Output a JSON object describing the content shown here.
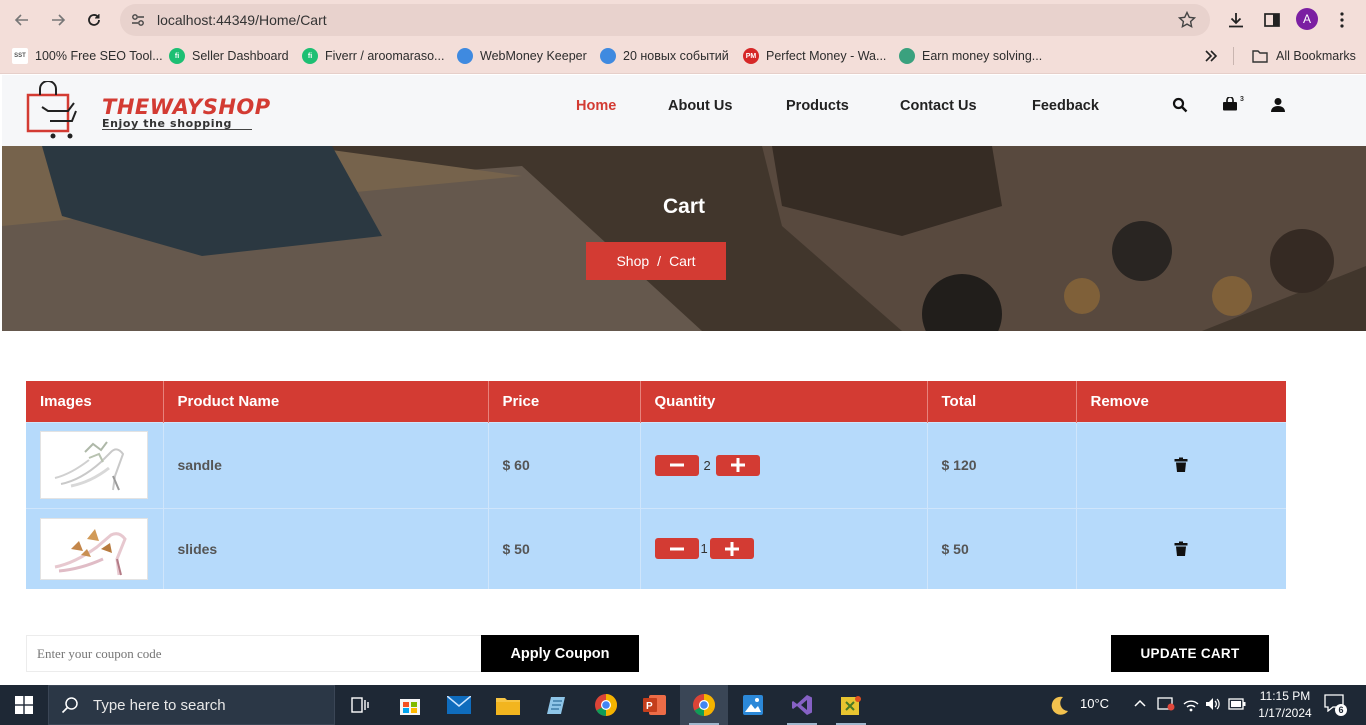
{
  "browser": {
    "url": "localhost:44349/Home/Cart",
    "profile_initial": "A",
    "bookmarks": [
      {
        "label": "100% Free SEO Tool...",
        "icon": "sst-icon",
        "badge": "SST"
      },
      {
        "label": "Seller Dashboard",
        "icon": "fiverr-icon",
        "badge": "fi"
      },
      {
        "label": "Fiverr / aroomaraso...",
        "icon": "fiverr-icon",
        "badge": "fi"
      },
      {
        "label": "WebMoney Keeper",
        "icon": "globe-icon",
        "badge": ""
      },
      {
        "label": "20 новых событий",
        "icon": "globe-icon",
        "badge": ""
      },
      {
        "label": "Perfect Money - Wa...",
        "icon": "perfect-money-icon",
        "badge": "PM"
      },
      {
        "label": "Earn money solving...",
        "icon": "shield-icon",
        "badge": ""
      }
    ],
    "all_bookmarks_label": "All Bookmarks"
  },
  "site": {
    "logo_title": "THEWAYSHOP",
    "logo_subtitle": "Enjoy the shopping",
    "nav": [
      "Home",
      "About Us",
      "Products",
      "Contact Us",
      "Feedback"
    ],
    "active_nav": "Home",
    "cart_badge": "3"
  },
  "hero": {
    "title": "Cart",
    "breadcrumb": {
      "shop": "Shop",
      "separator": "/",
      "current": "Cart"
    }
  },
  "cart": {
    "headers": [
      "Images",
      "Product Name",
      "Price",
      "Quantity",
      "Total",
      "Remove"
    ],
    "rows": [
      {
        "name": "sandle",
        "price": "$ 60",
        "quantity": "2",
        "total": "$ 120"
      },
      {
        "name": "slides",
        "price": "$ 50",
        "quantity": "1",
        "total": "$ 50"
      }
    ]
  },
  "coupon": {
    "placeholder": "Enter your coupon code",
    "apply_label": "Apply Coupon",
    "update_label": "UPDATE CART"
  },
  "taskbar": {
    "search_placeholder": "Type here to search",
    "temperature": "10°C",
    "time": "11:15 PM",
    "date": "1/17/2024",
    "notification_count": "6"
  },
  "colors": {
    "accent": "#d33b33",
    "row_bg": "#b6dafb",
    "chrome_bg": "#f3ded9",
    "taskbar_bg": "#1e2835"
  }
}
